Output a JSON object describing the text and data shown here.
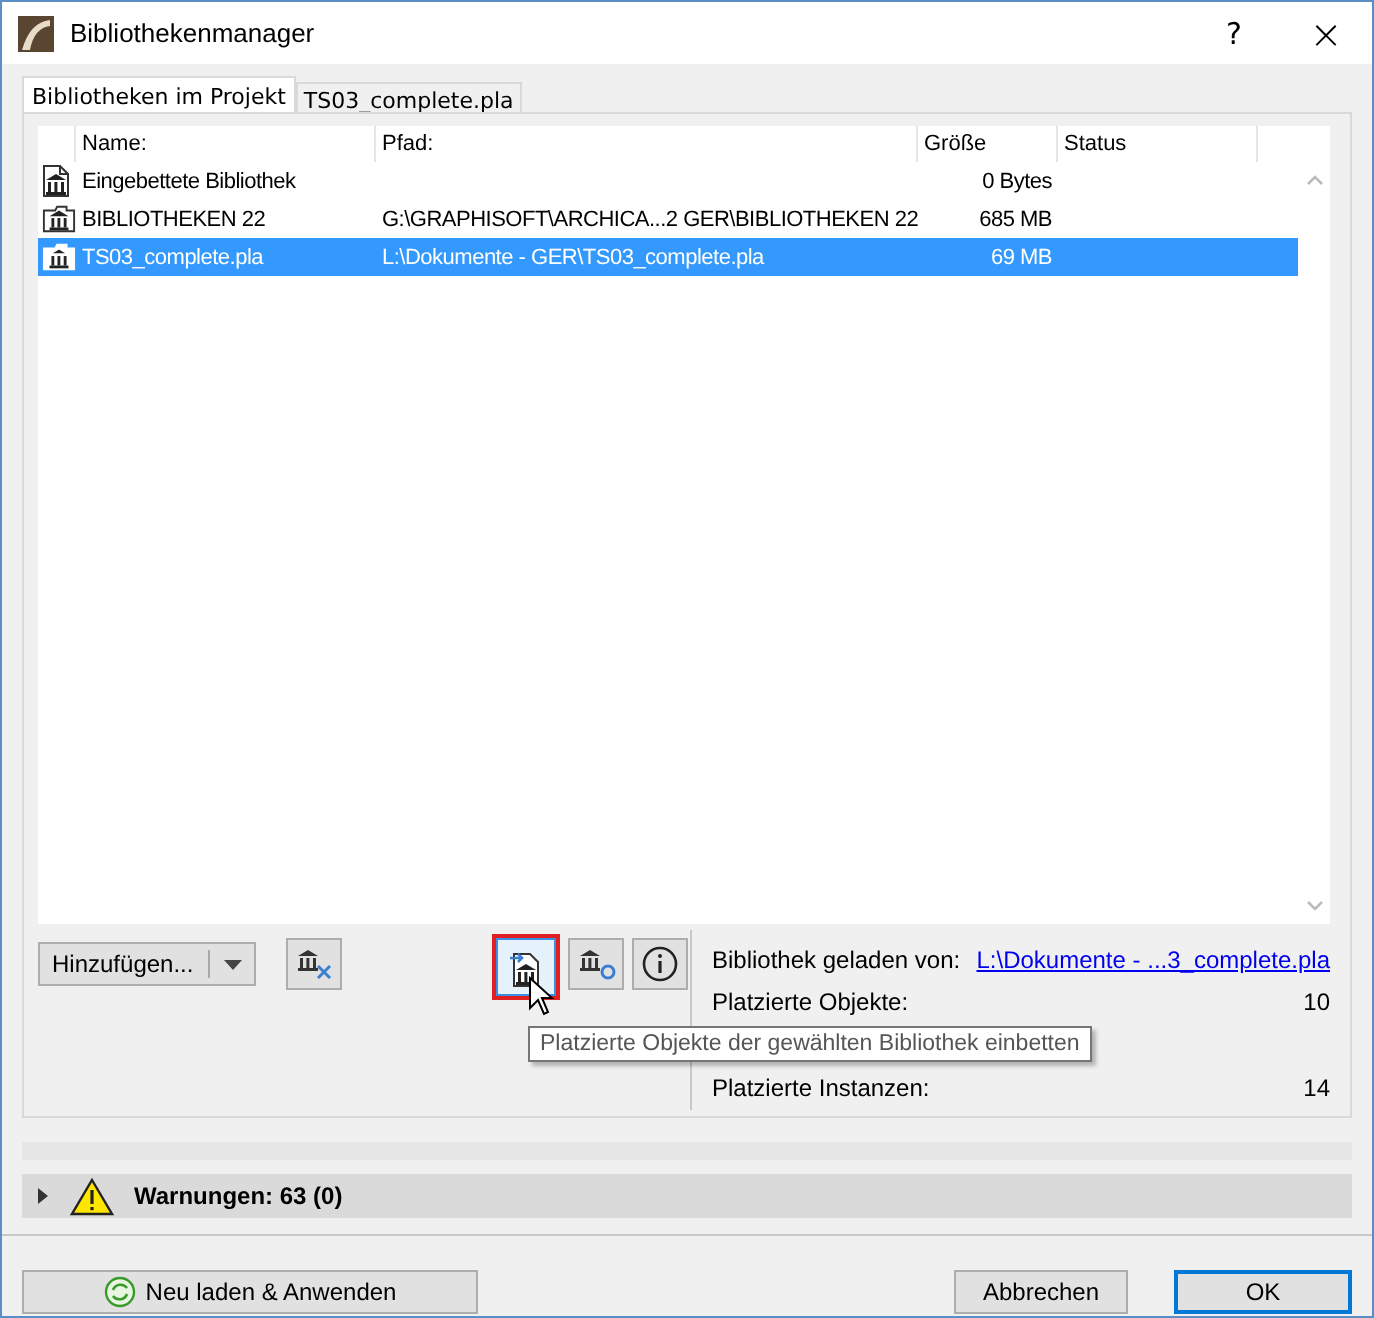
{
  "window": {
    "title": "Bibliothekenmanager",
    "help": "?",
    "close": "×"
  },
  "tabs": [
    {
      "label": "Bibliotheken im Projekt",
      "selected": true
    },
    {
      "label": "TS03_complete.pla",
      "selected": false
    }
  ],
  "table": {
    "columns": [
      "Name:",
      "Pfad:",
      "Größe",
      "Status"
    ],
    "rows": [
      {
        "kind": "embedded",
        "name": "Eingebettete Bibliothek",
        "path": "",
        "size": "0 Bytes",
        "selected": false
      },
      {
        "kind": "folder",
        "name": "BIBLIOTHEKEN 22",
        "path": "G:\\GRAPHISOFT\\ARCHICA...2 GER\\BIBLIOTHEKEN 22",
        "size": "685 MB",
        "selected": false
      },
      {
        "kind": "folder",
        "name": "TS03_complete.pla",
        "path": "L:\\Dokumente - GER\\TS03_complete.pla",
        "size": "69 MB",
        "selected": true
      }
    ]
  },
  "toolbar": {
    "add": "Hinzufügen...",
    "tooltip": "Platzierte Objekte der gewählten Bibliothek einbetten"
  },
  "info": {
    "loaded_label": "Bibliothek geladen von:",
    "loaded_link": "L:\\Dokumente - ...3_complete.pla",
    "stats": [
      {
        "label": "Platzierte Objekte:",
        "value": "10"
      },
      {
        "label": "Platzierte Instanzen:",
        "value": "14"
      }
    ]
  },
  "progress": {
    "level": 0
  },
  "warnings": {
    "label": "Warnungen: 63 (0)",
    "expanded": false
  },
  "buttons": [
    {
      "kind": "reload",
      "label": "Neu laden & Anwenden",
      "default": false
    },
    {
      "kind": "plain",
      "label": "Abbrechen",
      "default": false
    },
    {
      "kind": "plain",
      "label": "OK",
      "default": true
    }
  ]
}
